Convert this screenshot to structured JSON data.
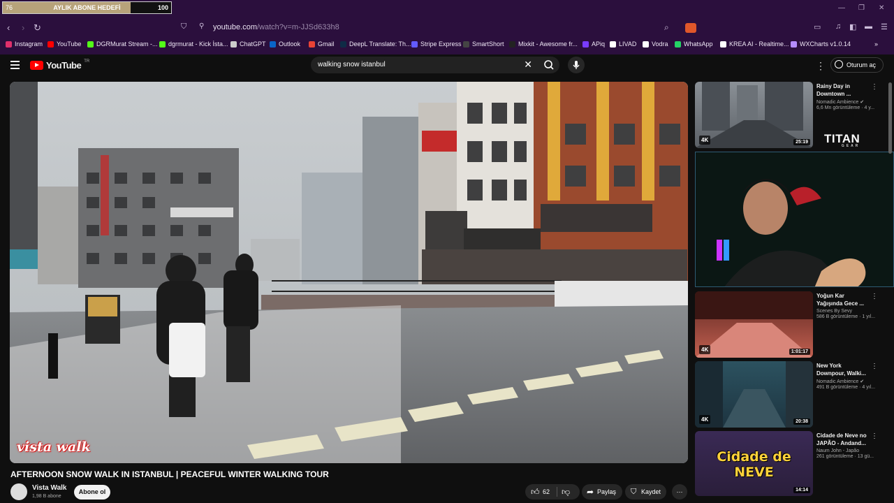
{
  "sub_goal": {
    "current": "76",
    "label": "AYLIK ABONE HEDEFİ",
    "target": "100",
    "progress": 0.76
  },
  "browser": {
    "url_host": "youtube.com",
    "url_path": "/watch?v=m-JJSd633h8",
    "bookmarks": [
      {
        "label": "Instagram",
        "color": "#e1306c"
      },
      {
        "label": "YouTube",
        "color": "#ff0000"
      },
      {
        "label": "DGRMurat Stream -...",
        "color": "#53fc18"
      },
      {
        "label": "dgrmurat - Kick İsta...",
        "color": "#53fc18"
      },
      {
        "label": "ChatGPT",
        "color": "#cccccc"
      },
      {
        "label": "Outlook",
        "color": "#0a64c8"
      },
      {
        "label": "Gmail",
        "color": "#ea4335"
      },
      {
        "label": "DeepL Translate: Th...",
        "color": "#0f2b46"
      },
      {
        "label": "Stripe Express",
        "color": "#635bff"
      },
      {
        "label": "SmartShort",
        "color": "#444444"
      },
      {
        "label": "Mixkit - Awesome fr...",
        "color": "#222222"
      },
      {
        "label": "APiq",
        "color": "#7a3cff"
      },
      {
        "label": "LIVAD",
        "color": "#ffffff"
      },
      {
        "label": "Vodra",
        "color": "#ffffff"
      },
      {
        "label": "WhatsApp",
        "color": "#25d366"
      },
      {
        "label": "KREA AI - Realtime...",
        "color": "#ffffff"
      },
      {
        "label": "WXCharts v1.0.14",
        "color": "#b58cff"
      }
    ]
  },
  "youtube": {
    "logo": "YouTube",
    "region": "TR",
    "search_query": "walking snow istanbul",
    "sign_in": "Oturum aç"
  },
  "video": {
    "overlay_logo": "vista walk",
    "title": "AFTERNOON SNOW WALK IN ISTANBUL | PEACEFUL WINTER WALKING TOUR",
    "channel": "Vista Walk",
    "subscribers": "1,98 B abone",
    "subscribe": "Abone ol",
    "likes": "62",
    "share": "Paylaş",
    "save": "Kaydet"
  },
  "overlay": {
    "brand": "TITAN",
    "brand_sub": "GEAR"
  },
  "recommendations": [
    {
      "title": "Rainy Day in\nDowntown ...",
      "channel": "Nomadic Ambience",
      "verified": true,
      "meta": "6,6 Mn görüntüleme · 4 y...",
      "duration": "25:19",
      "badge": "4K"
    },
    {
      "title": "Yoğun Kar\nYağışında Gece ...",
      "channel": "",
      "verified": false,
      "meta": "586 B görüntüleme · 1 yıl...",
      "duration": "1:01:17",
      "badge": "4K"
    },
    {
      "title": "New York\nDownpour, Walki...",
      "channel": "Nomadic Ambience",
      "verified": true,
      "meta": "491 B görüntüleme · 4 yıl...",
      "duration": "20:38",
      "badge": "4K"
    },
    {
      "title": "Cidade de Neve no\nJAPÃO - Andand...",
      "channel": "Naum John - Japão",
      "verified": false,
      "meta": "261 görüntüleme · 13 gü...",
      "duration": "14:14",
      "badge": "",
      "thumb_text": "Cidade de NEVE"
    }
  ],
  "recommendation_2_channel": "Scenes By Sevy"
}
